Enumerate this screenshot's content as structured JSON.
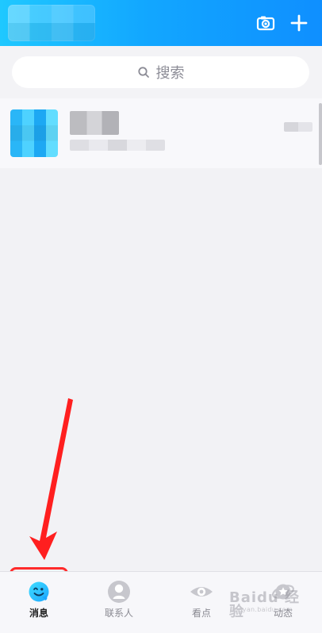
{
  "search": {
    "placeholder": "搜索"
  },
  "header": {
    "icons": {
      "camera": "camera-icon",
      "plus": "plus-icon"
    }
  },
  "bottom_nav": {
    "items": [
      {
        "label": "消息",
        "icon": "messages-icon"
      },
      {
        "label": "联系人",
        "icon": "contacts-icon"
      },
      {
        "label": "看点",
        "icon": "eye-icon"
      },
      {
        "label": "动态",
        "icon": "star-planet-icon"
      }
    ]
  },
  "watermark": {
    "text": "Baidu 经验",
    "url": "jingyan.baidu.com"
  },
  "colors": {
    "header_start": "#1fc8ff",
    "header_end": "#0f8fff",
    "active_border": "#ff2a2a",
    "arrow": "#ff1f1f"
  }
}
